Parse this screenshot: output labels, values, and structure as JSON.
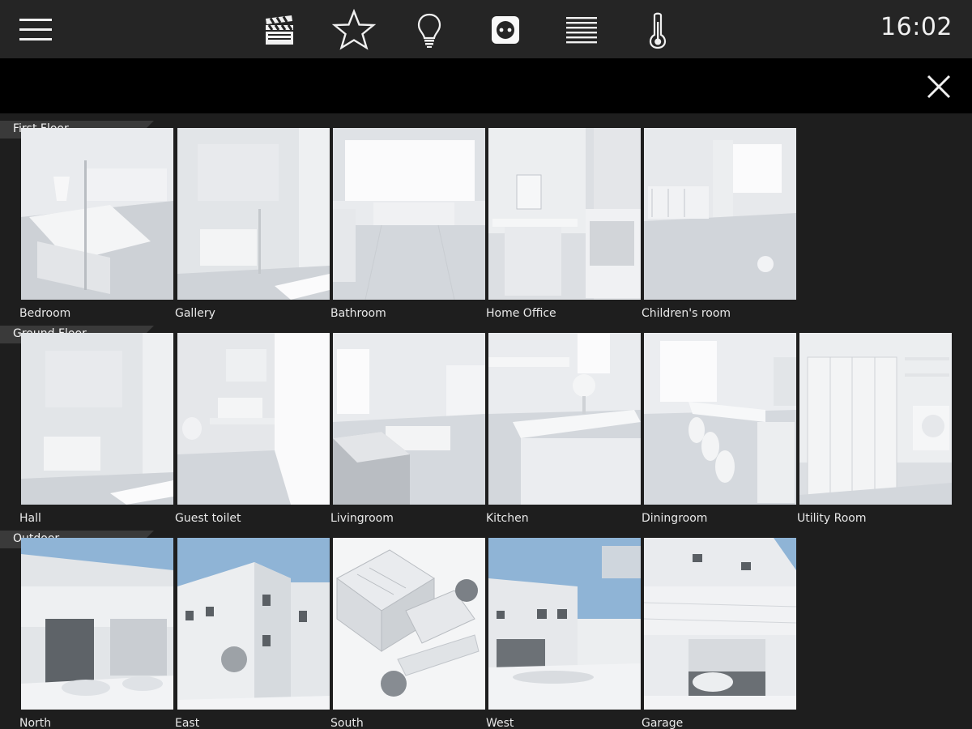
{
  "header": {
    "time": "16:02",
    "icons": [
      "menu-icon",
      "clapperboard-icon",
      "star-icon",
      "lightbulb-icon",
      "socket-icon",
      "blinds-icon",
      "thermometer-icon"
    ]
  },
  "subheader": {
    "close_icon": "close-icon"
  },
  "floors": [
    {
      "name": "First Floor",
      "rooms": [
        "Bedroom",
        "Gallery",
        "Bathroom",
        "Home Office",
        "Children's room"
      ]
    },
    {
      "name": "Ground Floor",
      "rooms": [
        "Hall",
        "Guest toilet",
        "Livingroom",
        "Kitchen",
        "Diningroom",
        "Utility Room"
      ]
    },
    {
      "name": "Outdoor",
      "rooms": [
        "North",
        "East",
        "South",
        "West",
        "Garage"
      ]
    }
  ],
  "colors": {
    "topbar": "#252525",
    "subbar": "#000000",
    "background": "#1e1e1e",
    "tile": "#dcdfe3",
    "sky": "#8fb4d6"
  }
}
